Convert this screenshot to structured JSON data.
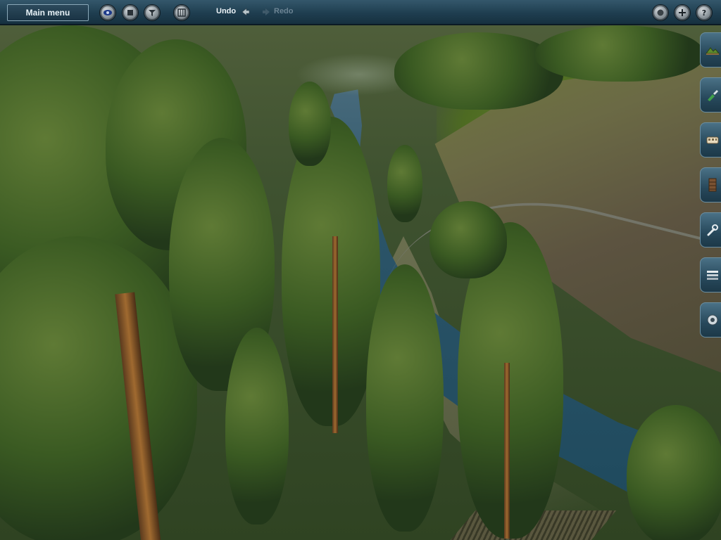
{
  "window": {
    "title": ""
  },
  "toolbar": {
    "main_menu_label": "Main menu",
    "buttons": [
      {
        "icon": "eye-icon",
        "name": "view-mode-button"
      },
      {
        "icon": "stop-icon",
        "name": "stop-button"
      },
      {
        "icon": "filter-icon",
        "name": "filter-button"
      },
      {
        "icon": "grid-icon",
        "name": "grid-button"
      }
    ],
    "undo_label": "Undo",
    "redo_label": "Redo",
    "redo_enabled": false,
    "right_buttons": [
      {
        "icon": "record-icon",
        "name": "record-button"
      },
      {
        "icon": "plus-icon",
        "name": "zoom-in-button"
      },
      {
        "icon": "help-icon",
        "name": "help-button"
      }
    ]
  },
  "side_palette": {
    "tabs": [
      {
        "icon": "terrain-icon",
        "name": "tab-terrain"
      },
      {
        "icon": "paint-icon",
        "name": "tab-paint"
      },
      {
        "icon": "objects-icon",
        "name": "tab-objects"
      },
      {
        "icon": "track-icon",
        "name": "tab-track"
      },
      {
        "icon": "wrench-icon",
        "name": "tab-tools"
      },
      {
        "icon": "layers-icon",
        "name": "tab-layers"
      },
      {
        "icon": "settings-icon",
        "name": "tab-settings"
      }
    ]
  },
  "colors": {
    "toolbar_bg": "#1f3e50",
    "toolbar_text": "#eef4f8",
    "disabled_text": "#6c8494",
    "river": "#1f4a5e",
    "forest": "#3a5a22"
  }
}
